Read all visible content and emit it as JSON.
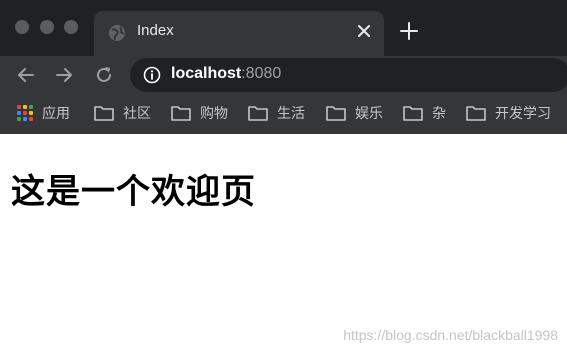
{
  "tab": {
    "title": "Index"
  },
  "address_bar": {
    "host": "localhost",
    "port": ":8080"
  },
  "bookmarks": [
    {
      "label": "应用",
      "icon": "apps-icon"
    },
    {
      "label": "社区",
      "icon": "folder-icon"
    },
    {
      "label": "购物",
      "icon": "folder-icon"
    },
    {
      "label": "生活",
      "icon": "folder-icon"
    },
    {
      "label": "娱乐",
      "icon": "folder-icon"
    },
    {
      "label": "杂",
      "icon": "folder-icon"
    },
    {
      "label": "开发学习",
      "icon": "folder-icon"
    }
  ],
  "page": {
    "heading": "这是一个欢迎页"
  },
  "watermark": "https://blog.csdn.net/blackball1998",
  "colors": {
    "titlebar": "#202124",
    "toolbar": "#35363a",
    "omnibox": "#202124",
    "tab_text": "#e8eaed",
    "bookmark_text": "#c4c7c5"
  }
}
